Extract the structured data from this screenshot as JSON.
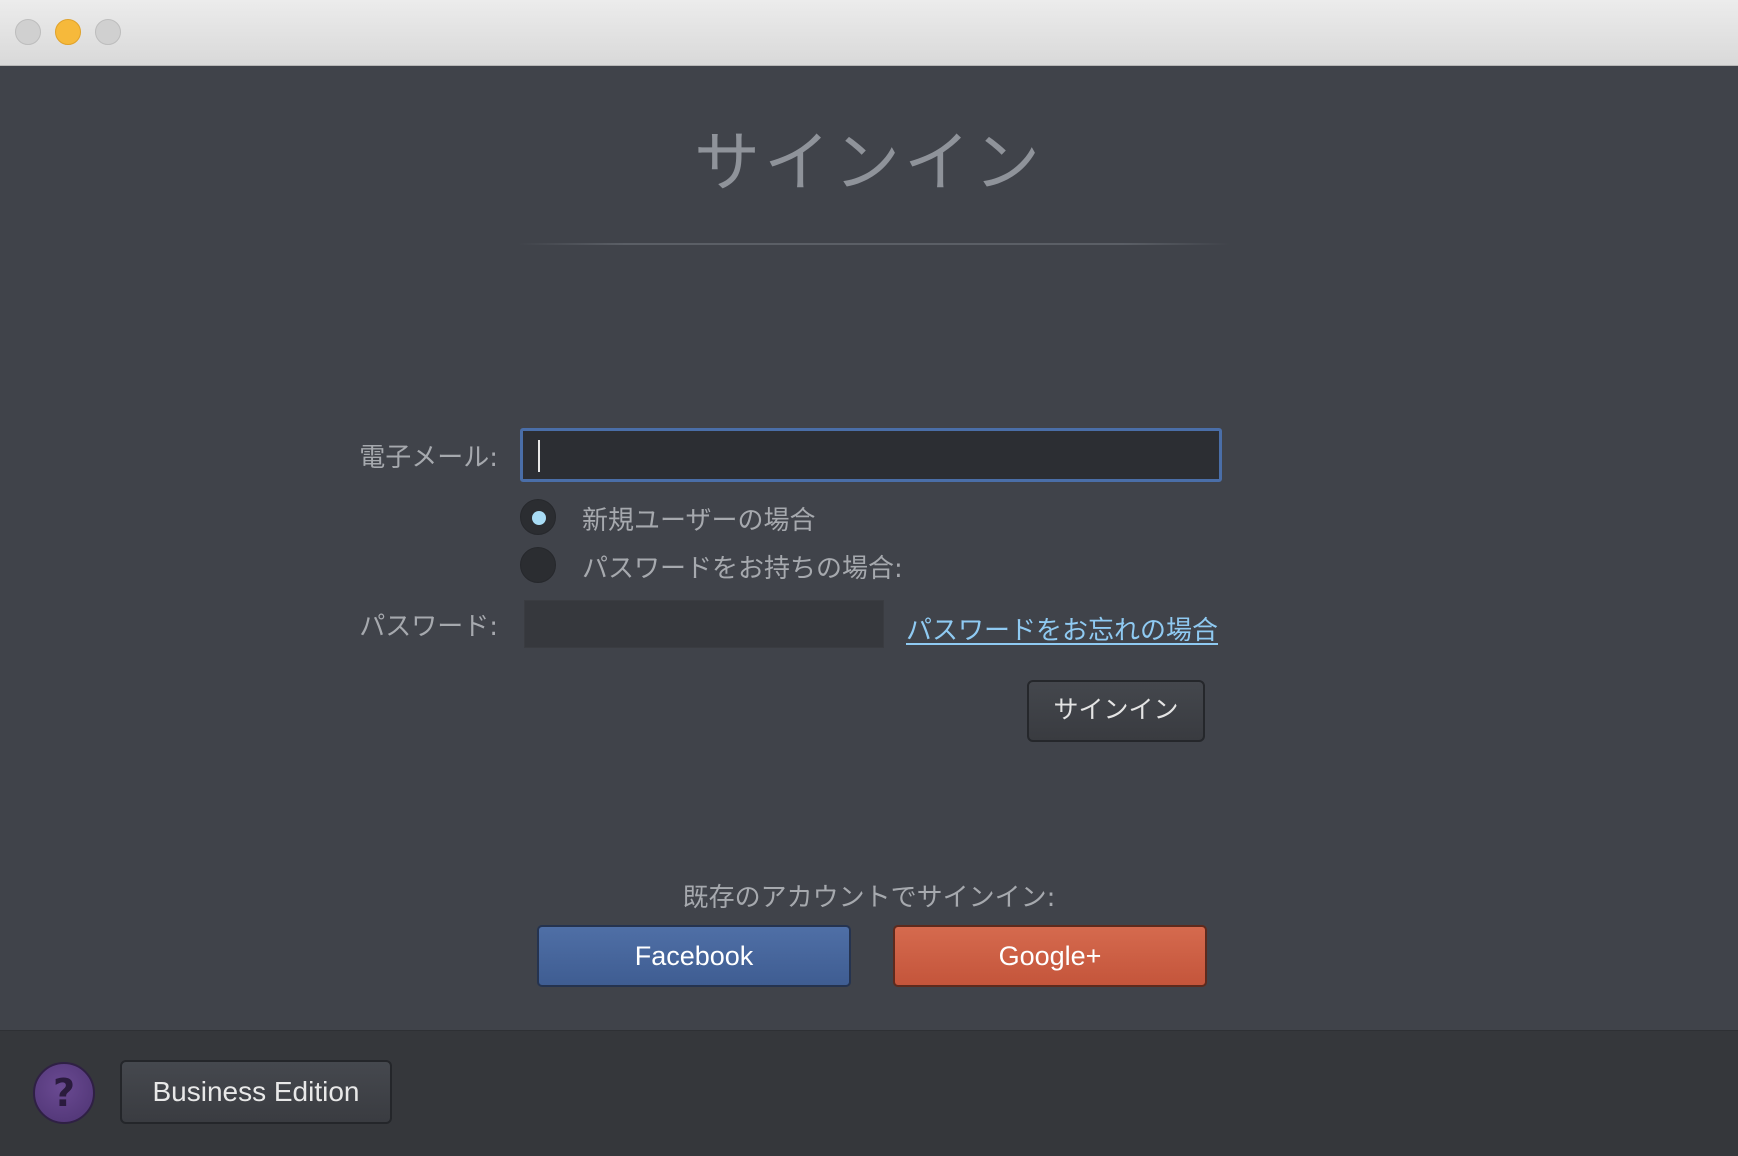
{
  "window": {
    "controls": [
      "close",
      "minimize",
      "zoom"
    ]
  },
  "header": {
    "title": "サインイン"
  },
  "form": {
    "email_label": "電子メール:",
    "email_value": "",
    "new_user_label": "新規ユーザーの場合",
    "existing_user_label": "パスワードをお持ちの場合:",
    "selected_option": "new_user",
    "password_label": "パスワード:",
    "password_value": "",
    "forgot_password_link": "パスワードをお忘れの場合",
    "signin_button": "サインイン"
  },
  "social": {
    "label": "既存のアカウントでサインイン:",
    "facebook_button": "Facebook",
    "google_button": "Google+",
    "facebook_color": "#4a69a0",
    "google_color": "#cf6047"
  },
  "footer": {
    "help_icon": "?",
    "business_button": "Business Edition"
  },
  "colors": {
    "background": "#40434a",
    "link": "#8fcaf2",
    "focus_border": "#4a6ea8",
    "radio_selected": "#a8dcf5"
  }
}
